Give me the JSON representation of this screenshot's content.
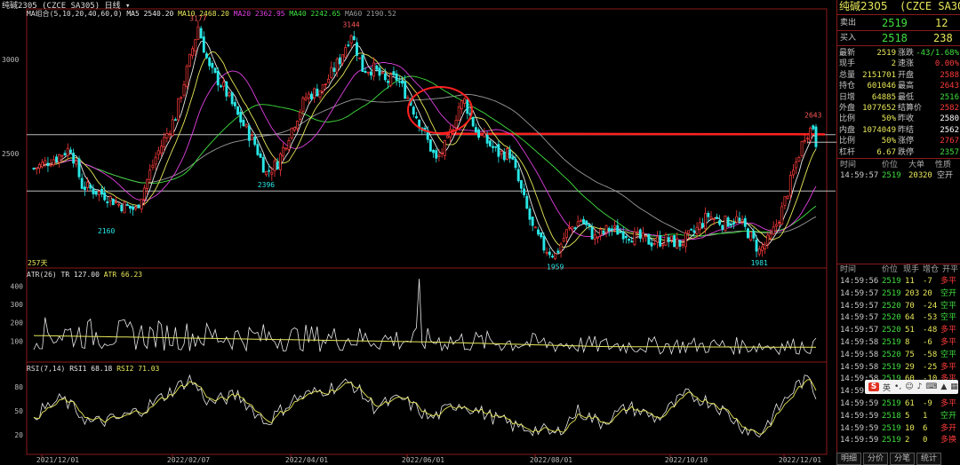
{
  "colors": {
    "up": "#ff3b3b",
    "down": "#29e6e6",
    "ma5": "#e8e8e8",
    "ma10": "#e8e85a",
    "ma20": "#e040e0",
    "ma40": "#3fe03f",
    "ma60": "#9a9a9a",
    "lineRed": "#ff2020"
  },
  "header": {
    "title": "纯碱2305",
    "contract": "(CZCE SA305)",
    "period": "日线",
    "ma_group": "MA组合(5,10,20,40,60,0)",
    "ma5": "MA5 2540.20",
    "ma10": "MA10 2468.20",
    "ma20": "MA20 2362.95",
    "ma40": "MA40 2242.65",
    "ma60": "MA60 2190.52"
  },
  "price_axis": {
    "labels": [
      "3000",
      "2500"
    ]
  },
  "price_annotations": {
    "high1": "3177",
    "high2": "3144",
    "low1": "2396",
    "low2": "2160",
    "low3": "1959",
    "low4": "1981",
    "last_high": "2643",
    "days": "257天"
  },
  "atr": {
    "title": "ATR(26)",
    "tr": "TR 127.00",
    "atr": "ATR 66.23",
    "axis": [
      "400",
      "300",
      "200",
      "100"
    ]
  },
  "rsi": {
    "title": "RSI(7,14)",
    "rsi1": "RSI1 68.18",
    "rsi2": "RSI2 71.03",
    "axis": [
      "80",
      "50",
      "20"
    ]
  },
  "dates": [
    "2021/12/01",
    "2022/02/07",
    "2022/04/01",
    "2022/06/01",
    "2022/08/01",
    "2022/10/10",
    "2022/12/01"
  ],
  "chart_data": {
    "type": "candlestick",
    "title": "纯碱2305 (CZCE SA305) 日线",
    "ylim": [
      1900,
      3260
    ],
    "anchors": [
      [
        0,
        2420
      ],
      [
        8,
        2480
      ],
      [
        13,
        2530
      ],
      [
        17,
        2330
      ],
      [
        25,
        2280
      ],
      [
        30,
        2230
      ],
      [
        36,
        2200
      ],
      [
        43,
        2480
      ],
      [
        50,
        2700
      ],
      [
        55,
        3000
      ],
      [
        58,
        3177
      ],
      [
        62,
        2950
      ],
      [
        67,
        2850
      ],
      [
        72,
        2700
      ],
      [
        78,
        2550
      ],
      [
        82,
        2396
      ],
      [
        86,
        2450
      ],
      [
        90,
        2600
      ],
      [
        96,
        2800
      ],
      [
        102,
        2850
      ],
      [
        108,
        3000
      ],
      [
        112,
        3144
      ],
      [
        116,
        2950
      ],
      [
        120,
        2950
      ],
      [
        124,
        2880
      ],
      [
        128,
        2900
      ],
      [
        132,
        2800
      ],
      [
        138,
        2600
      ],
      [
        142,
        2460
      ],
      [
        146,
        2560
      ],
      [
        150,
        2750
      ],
      [
        152,
        2780
      ],
      [
        156,
        2620
      ],
      [
        160,
        2560
      ],
      [
        164,
        2500
      ],
      [
        168,
        2500
      ],
      [
        172,
        2300
      ],
      [
        176,
        2100
      ],
      [
        180,
        2000
      ],
      [
        184,
        1959
      ],
      [
        188,
        2080
      ],
      [
        193,
        2150
      ],
      [
        198,
        2050
      ],
      [
        203,
        2100
      ],
      [
        208,
        2080
      ],
      [
        213,
        2050
      ],
      [
        218,
        2030
      ],
      [
        223,
        2040
      ],
      [
        228,
        2020
      ],
      [
        233,
        2080
      ],
      [
        238,
        2170
      ],
      [
        243,
        2130
      ],
      [
        248,
        2150
      ],
      [
        252,
        2080
      ],
      [
        256,
        1981
      ],
      [
        260,
        2050
      ],
      [
        264,
        2200
      ],
      [
        268,
        2400
      ],
      [
        272,
        2600
      ],
      [
        275,
        2643
      ],
      [
        276,
        2560
      ]
    ],
    "atr_level": [
      [
        0,
        130
      ],
      [
        60,
        115
      ],
      [
        140,
        95
      ],
      [
        200,
        70
      ],
      [
        276,
        66
      ]
    ],
    "atr_spike_index": 136,
    "atr_spike_value": 440,
    "rsi_anchors": [
      [
        0,
        45
      ],
      [
        10,
        65
      ],
      [
        20,
        35
      ],
      [
        30,
        40
      ],
      [
        40,
        55
      ],
      [
        55,
        90
      ],
      [
        62,
        60
      ],
      [
        72,
        70
      ],
      [
        82,
        35
      ],
      [
        92,
        65
      ],
      [
        104,
        78
      ],
      [
        112,
        85
      ],
      [
        120,
        55
      ],
      [
        130,
        65
      ],
      [
        140,
        40
      ],
      [
        150,
        60
      ],
      [
        160,
        45
      ],
      [
        170,
        30
      ],
      [
        180,
        25
      ],
      [
        184,
        20
      ],
      [
        192,
        50
      ],
      [
        200,
        35
      ],
      [
        210,
        55
      ],
      [
        220,
        40
      ],
      [
        230,
        70
      ],
      [
        240,
        60
      ],
      [
        250,
        30
      ],
      [
        256,
        20
      ],
      [
        262,
        50
      ],
      [
        270,
        85
      ],
      [
        274,
        88
      ],
      [
        276,
        68
      ]
    ],
    "x_categories": [
      "2021/12/01",
      "2022/02/07",
      "2022/04/01",
      "2022/06/01",
      "2022/08/01",
      "2022/10/10",
      "2022/12/01"
    ]
  },
  "quote": {
    "sell_label": "卖出",
    "sell_price": "2519",
    "sell_vol": "12",
    "buy_label": "买入",
    "buy_price": "2518",
    "buy_vol": "238",
    "rows": [
      [
        "最新",
        "2519",
        "涨跌",
        "-43/1.68%"
      ],
      [
        "现手",
        "2",
        "速涨",
        "0.00%"
      ],
      [
        "总量",
        "2151701",
        "开盘",
        "2588"
      ],
      [
        "持仓",
        "601046",
        "最高",
        "2643"
      ],
      [
        "日增",
        "64885",
        "最低",
        "2516"
      ],
      [
        "外盘",
        "1077652",
        "结算价",
        "2582"
      ],
      [
        "比例",
        "50%",
        "昨收",
        "2580"
      ],
      [
        "内盘",
        "1074049",
        "昨结",
        "2562"
      ],
      [
        "比例",
        "50%",
        "涨停",
        "2767"
      ],
      [
        "杠杆",
        "6.67",
        "跌停",
        "2357"
      ]
    ],
    "tick_head": [
      "时间",
      "价位",
      "大单",
      "性质"
    ],
    "tick_first": [
      "14:59:57",
      "2519",
      "203",
      "20",
      "空开"
    ],
    "tick_head2": [
      "时间",
      "价位",
      "现手",
      "增仓",
      "开平"
    ],
    "ticks": [
      [
        "14:59:56",
        "2519",
        "11",
        "-7",
        "多平"
      ],
      [
        "14:59:57",
        "2519",
        "203",
        "20",
        "空开"
      ],
      [
        "14:59:57",
        "2520",
        "70",
        "-24",
        "空平"
      ],
      [
        "14:59:57",
        "2520",
        "64",
        "-53",
        "空平"
      ],
      [
        "14:59:57",
        "2520",
        "51",
        "-48",
        "多平"
      ],
      [
        "14:59:58",
        "2519",
        "8",
        "-6",
        "多平"
      ],
      [
        "14:59:58",
        "2520",
        "75",
        "-58",
        "空平"
      ],
      [
        "14:59:58",
        "2519",
        "29",
        "-25",
        "多平"
      ],
      [
        "14:59:58",
        "2519",
        "60",
        "-10",
        "多平"
      ],
      [
        "14:59:59",
        "2519",
        "",
        "",
        ""
      ],
      [
        "14:59:59",
        "2519",
        "61",
        "-9",
        "多平"
      ],
      [
        "14:59:59",
        "2518",
        "5",
        "1",
        "空开"
      ],
      [
        "14:59:59",
        "2519",
        "10",
        "6",
        "多开"
      ],
      [
        "14:59:59",
        "2519",
        "2",
        "0",
        "多换"
      ]
    ]
  },
  "tabs": [
    "明细",
    "分价",
    "分笔",
    "统计"
  ],
  "ime": {
    "lang": "英"
  }
}
